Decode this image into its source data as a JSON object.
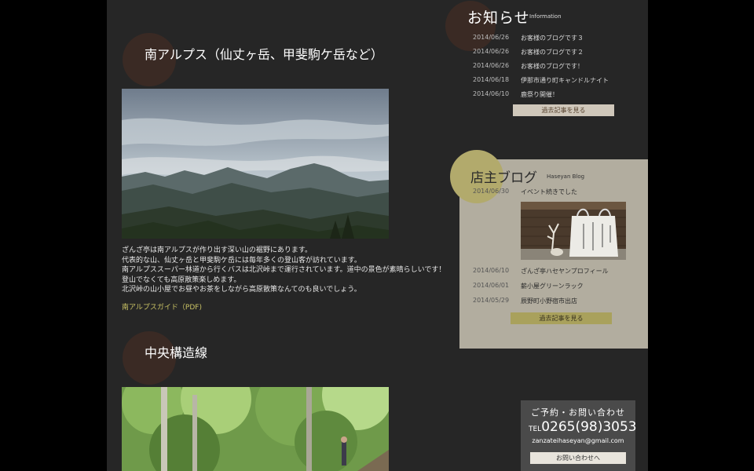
{
  "main": {
    "section1": {
      "title": "南アルプス（仙丈ヶ岳、甲斐駒ケ岳など）",
      "paragraph": [
        "ざんざ亭は南アルプスが作り出す深い山の裾野にあります。",
        "代表的な山、仙丈ヶ岳と甲斐駒ケ岳には毎年多くの登山客が訪れています。",
        "南アルプススーパー林道から行くバスは北沢峠まで運行されています。道中の景色が素晴らしいです！",
        "登山でなくても高原散策楽しめます。",
        "北沢峠の山小屋でお昼やお茶をしながら高原散策なんてのも良いでしょう。"
      ],
      "link": "南アルプスガイド（PDF)"
    },
    "section2": {
      "title": "中央構造線"
    }
  },
  "news": {
    "title": "お知らせ",
    "subtitle": "Information",
    "items": [
      {
        "date": "2014/06/26",
        "text": "お客様のブログです３"
      },
      {
        "date": "2014/06/26",
        "text": "お客様のブログです２"
      },
      {
        "date": "2014/06/26",
        "text": "お客様のブログです！"
      },
      {
        "date": "2014/06/18",
        "text": "伊那市通り町キャンドルナイト"
      },
      {
        "date": "2014/06/10",
        "text": "鹿祭り開催！"
      }
    ],
    "more": "過去記事を見る"
  },
  "blog": {
    "title": "店主ブログ",
    "subtitle": "Haseyan Blog",
    "featured": {
      "date": "2014/06/30",
      "text": "イベント続きでした"
    },
    "items": [
      {
        "date": "2014/06/10",
        "text": "ざんざ亭ハセヤンプロフィール"
      },
      {
        "date": "2014/06/01",
        "text": "薪小屋グリーンラック"
      },
      {
        "date": "2014/05/29",
        "text": "辰野町小野宿市出店"
      }
    ],
    "more": "過去記事を見る"
  },
  "contact": {
    "heading": "ご予約・お問い合わせ",
    "tel_label": "TEL",
    "tel": "0265(98)3053",
    "email": "zanzateihaseyan@gmail.com",
    "button": "お問い合わせへ"
  },
  "colors": {
    "page_bg": "#262626",
    "accent_circle": "#3a2a24",
    "blog_panel": "#b2ad9f",
    "blog_circle": "#b2aa6c",
    "link_gold": "#c9c264"
  }
}
